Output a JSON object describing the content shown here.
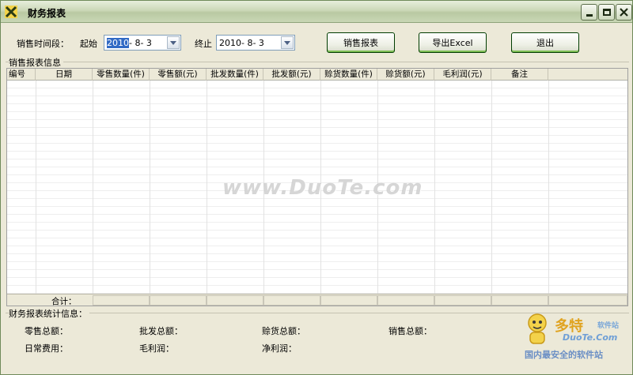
{
  "window": {
    "title": "财务报表"
  },
  "header": {
    "range_label": "销售时间段：",
    "start_label": "起始",
    "start_year": "2010",
    "start_rest": "- 8- 3",
    "end_label": "终止",
    "end_value": "2010- 8- 3",
    "buttons": {
      "report": "销售报表",
      "export": "导出Excel",
      "exit": "退出"
    }
  },
  "report_group": {
    "title": "销售报表信息"
  },
  "table": {
    "columns": [
      "编号",
      "日期",
      "零售数量(件)",
      "零售额(元)",
      "批发数量(件)",
      "批发额(元)",
      "赊货数量(件)",
      "赊货额(元)",
      "毛利润(元)",
      "备注"
    ],
    "rows": [],
    "total_label": "合计："
  },
  "stats_group": {
    "title": "财务报表统计信息：",
    "retail_total": "零售总额：",
    "wholesale_total": "批发总额：",
    "credit_total": "赊货总额：",
    "sales_total": "销售总额：",
    "daily_expense": "日常费用：",
    "gross_profit": "毛利润：",
    "net_profit": "净利润："
  },
  "watermark": "www.DuoTe.com",
  "logo": {
    "main": "多特",
    "sub": "软件站",
    "url": "DuoTe.Com",
    "slogan": "国内最安全的软件站"
  }
}
